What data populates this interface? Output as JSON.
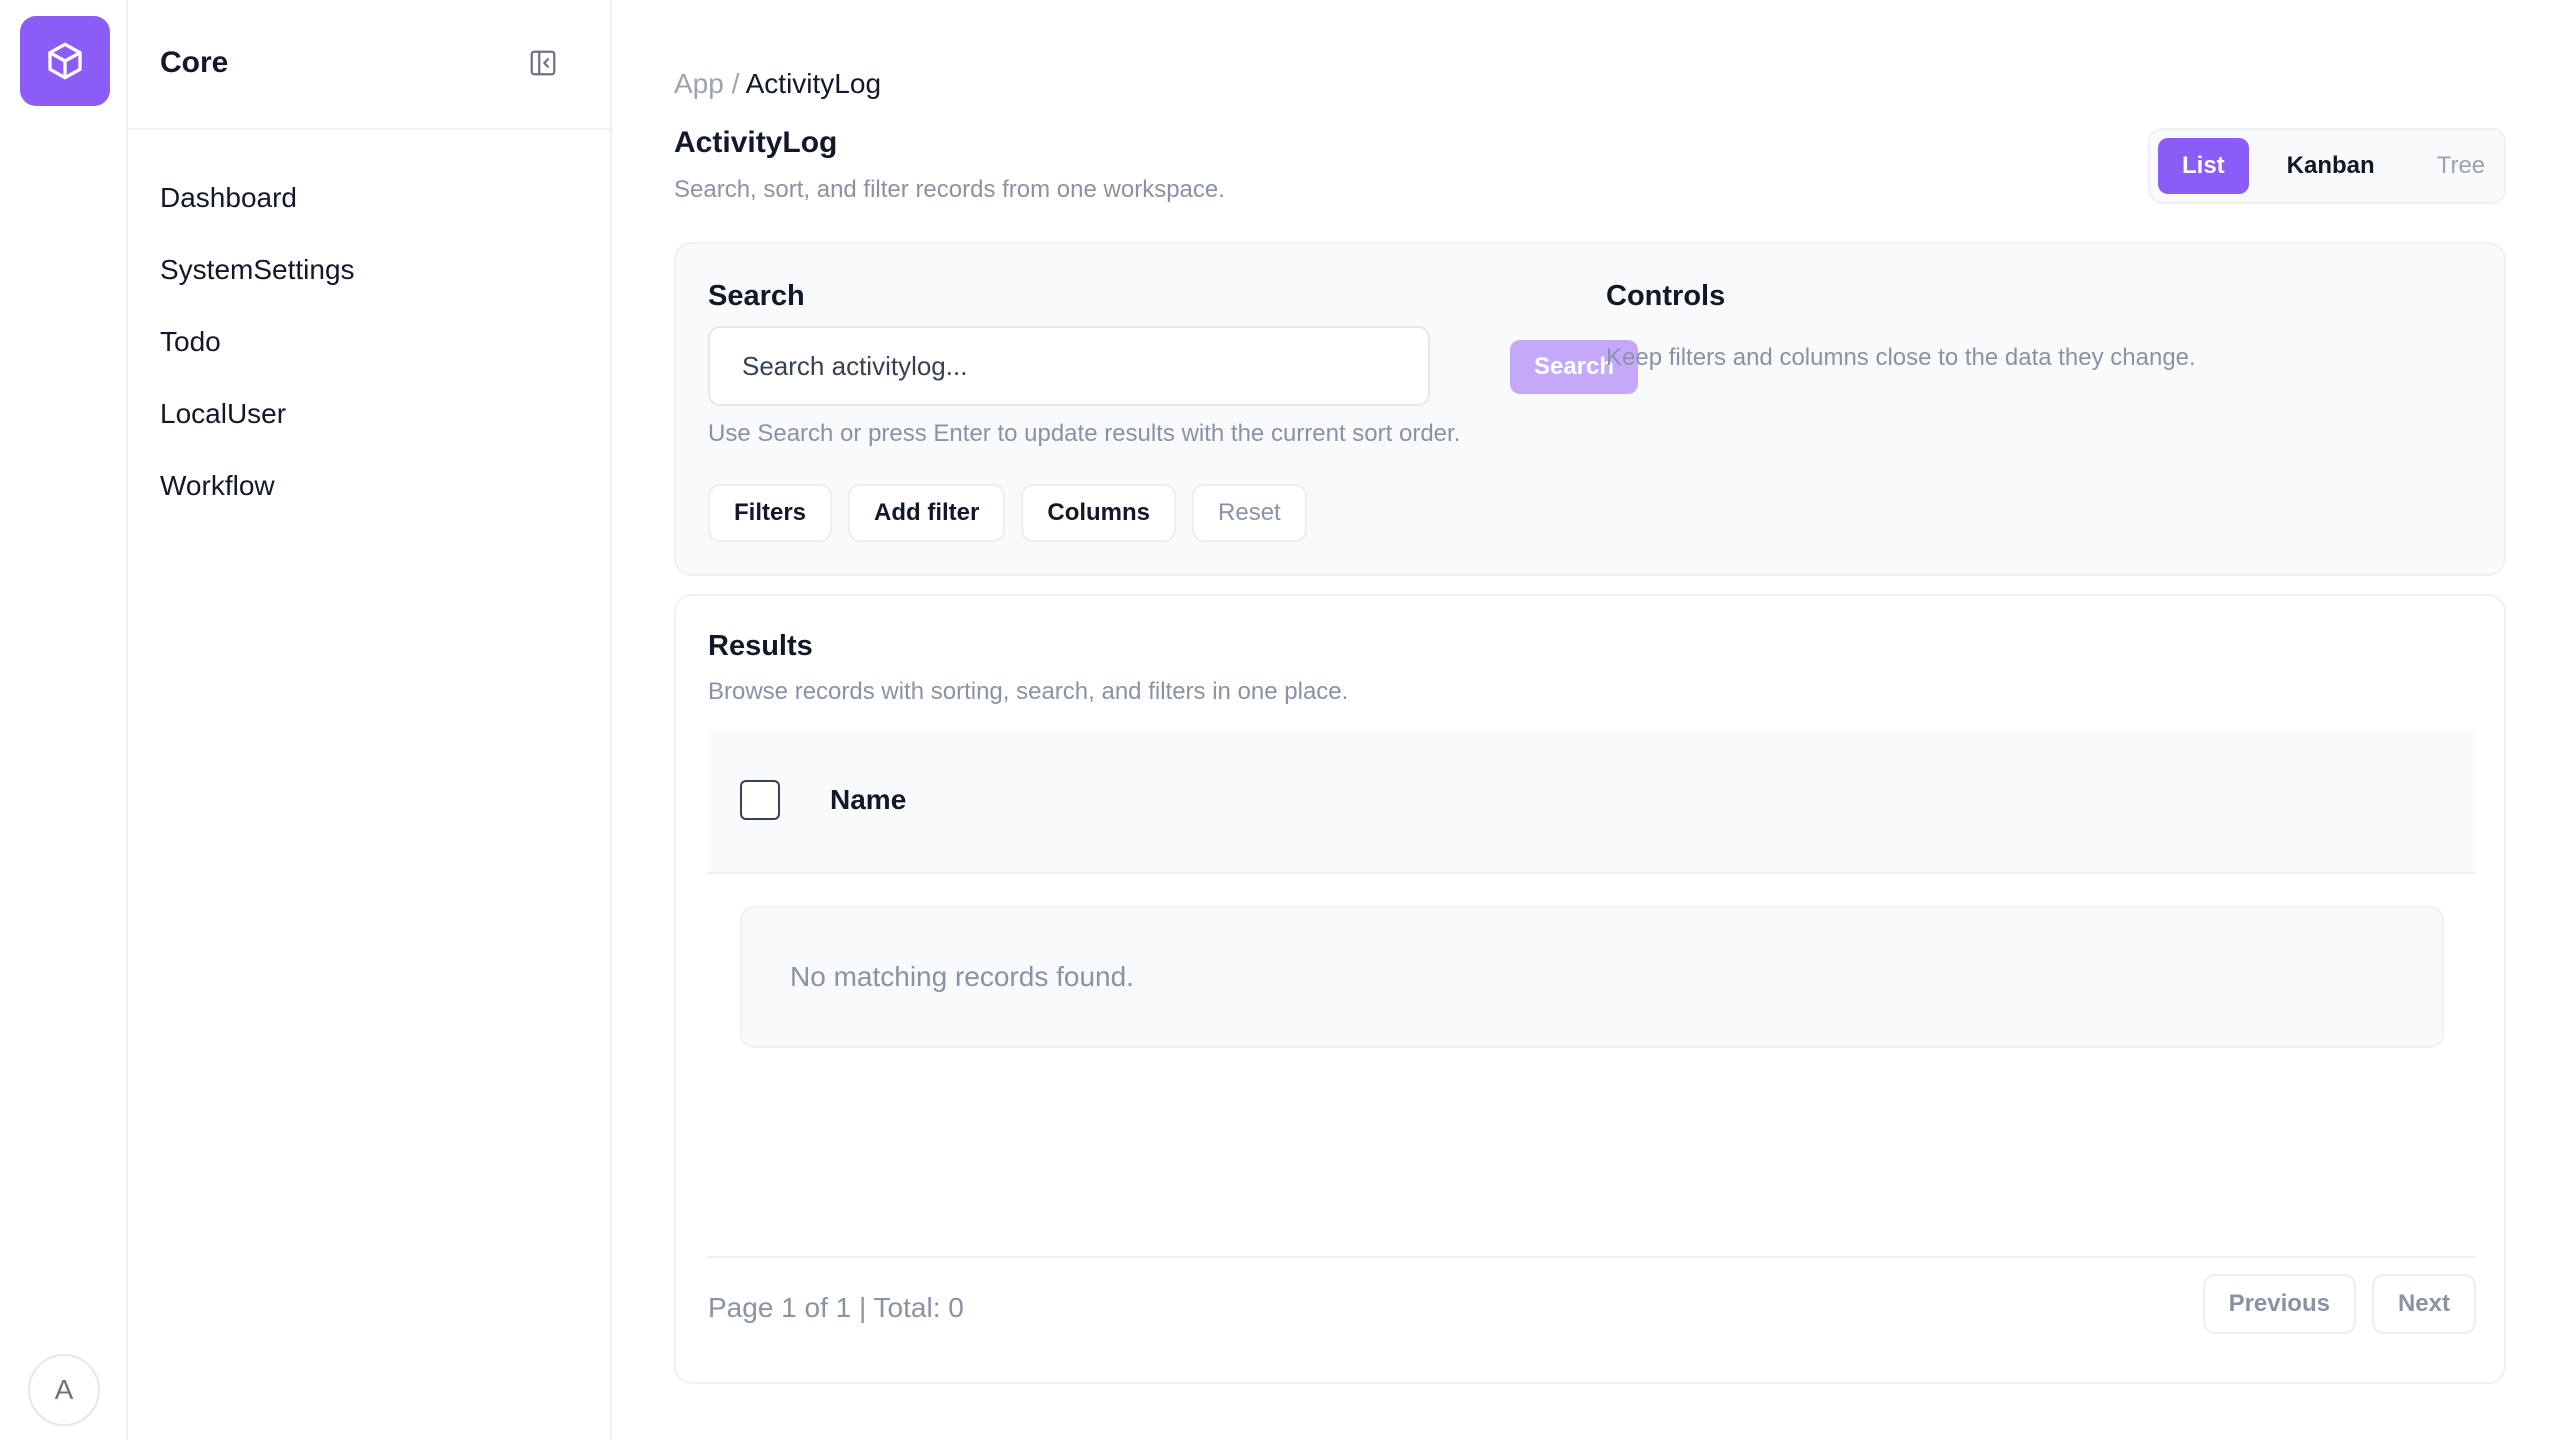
{
  "app": {
    "rail_logo_icon": "cube-icon",
    "avatar_initial": "A"
  },
  "sidebar": {
    "title": "Core",
    "collapse_icon": "sidebar-collapse-icon",
    "items": [
      {
        "label": "Dashboard"
      },
      {
        "label": "SystemSettings"
      },
      {
        "label": "Todo"
      },
      {
        "label": "LocalUser"
      },
      {
        "label": "Workflow"
      }
    ]
  },
  "header": {
    "breadcrumb_root": "App",
    "breadcrumb_sep": "/",
    "breadcrumb_current": "ActivityLog",
    "title": "ActivityLog",
    "subtitle": "Search, sort, and filter records from one workspace."
  },
  "view_switch": {
    "options": [
      {
        "label": "List",
        "active": true
      },
      {
        "label": "Kanban"
      },
      {
        "label": "Tree"
      }
    ]
  },
  "search": {
    "heading": "Search",
    "placeholder": "Search activitylog...",
    "value": "",
    "button_label": "Search",
    "hint": "Use Search or press Enter to update results with the current sort order.",
    "chips": [
      {
        "label": "Filters"
      },
      {
        "label": "Add filter"
      },
      {
        "label": "Columns"
      },
      {
        "label": "Reset"
      }
    ]
  },
  "controls": {
    "heading": "Controls",
    "description": "Keep filters and columns close to the data they change."
  },
  "results": {
    "heading": "Results",
    "subtitle": "Browse records with sorting, search, and filters in one place.",
    "columns": [
      "Name"
    ],
    "rows": [],
    "empty_message": "No matching records found.",
    "page_info": "Page 1 of 1 | Total: 0",
    "prev_label": "Previous",
    "next_label": "Next"
  },
  "colors": {
    "accent": "#8b5cf6",
    "accent_disabled": "#c4a9fb"
  }
}
